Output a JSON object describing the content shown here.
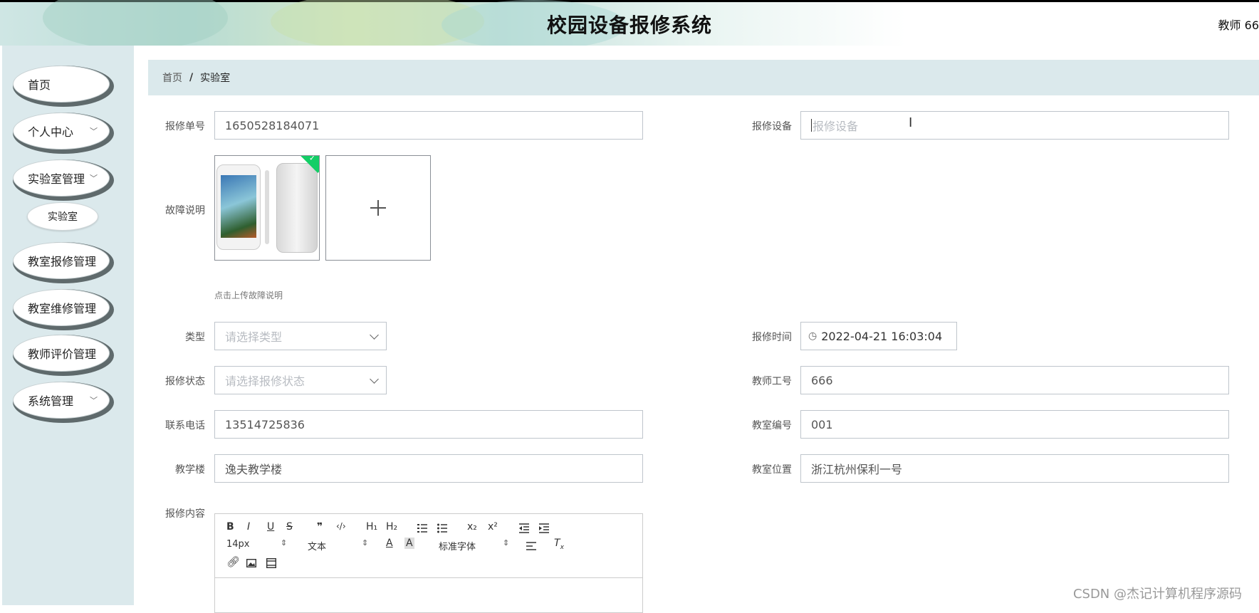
{
  "header": {
    "title": "校园设备报修系统",
    "user": "教师 66"
  },
  "sidebar": {
    "items": [
      {
        "label": "首页"
      },
      {
        "label": "个人中心",
        "has_submenu": true
      },
      {
        "label": "实验室管理",
        "has_submenu": true
      },
      {
        "label": "实验室",
        "is_sub": true
      },
      {
        "label": "教室报修管理"
      },
      {
        "label": "教室维修管理"
      },
      {
        "label": "教师评价管理"
      },
      {
        "label": "系统管理",
        "has_submenu": true
      }
    ]
  },
  "breadcrumb": {
    "home": "首页",
    "separator": "/",
    "current": "实验室"
  },
  "form": {
    "order_no": {
      "label": "报修单号",
      "value": "1650528184071"
    },
    "device": {
      "label": "报修设备",
      "placeholder": "报修设备"
    },
    "fault": {
      "label": "故障说明",
      "hint": "点击上传故障说明"
    },
    "type": {
      "label": "类型",
      "placeholder": "请选择类型"
    },
    "report_time": {
      "label": "报修时间",
      "value": "2022-04-21 16:03:04"
    },
    "status": {
      "label": "报修状态",
      "placeholder": "请选择报修状态"
    },
    "teacher_no": {
      "label": "教师工号",
      "value": "666"
    },
    "phone": {
      "label": "联系电话",
      "value": "13514725836"
    },
    "room_no": {
      "label": "教室编号",
      "value": "001"
    },
    "building": {
      "label": "教学楼",
      "value": "逸夫教学楼"
    },
    "location": {
      "label": "教室位置",
      "value": "浙江杭州保利一号"
    },
    "content": {
      "label": "报修内容"
    }
  },
  "editor": {
    "toolbar_row1": [
      "B",
      "I",
      "U",
      "S",
      "❞",
      "‹/›",
      "H₁",
      "H₂",
      "ol",
      "ul",
      "x₂",
      "x²",
      "outdent",
      "indent"
    ],
    "font_size": "14px",
    "text_style": "文本",
    "font_family": "标准字体"
  },
  "watermark": "CSDN @杰记计算机程序源码",
  "colors": {
    "sidebar_bg": "#dbe9ec",
    "badge_green": "#13ce66",
    "input_border": "#bfc5cc"
  }
}
